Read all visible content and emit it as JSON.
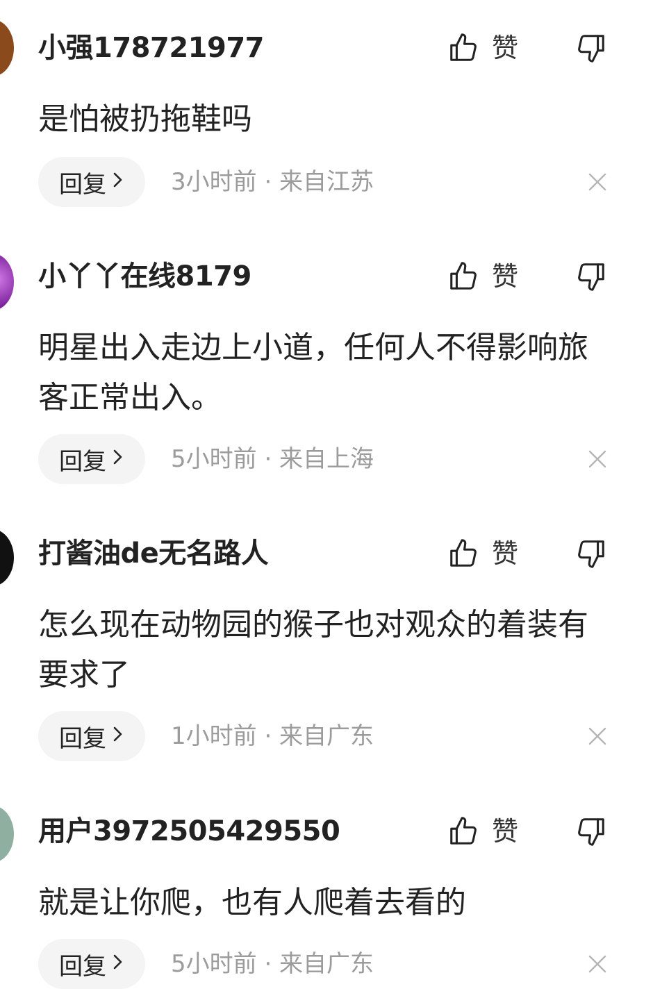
{
  "comments": [
    {
      "username": "小强178721977",
      "text": "是怕被扔拖鞋吗",
      "like_label": "赞",
      "reply_label": "回复",
      "meta": "3小时前 · 来自江苏",
      "avatar_color": "#8a4a1c"
    },
    {
      "username": "小丫丫在线8179",
      "text": "明星出入走边上小道，任何人不得影响旅客正常出入。",
      "like_label": "赞",
      "reply_label": "回复",
      "meta": "5小时前 · 来自上海",
      "avatar_color": "#a43bc4"
    },
    {
      "username": "打酱油de无名路人",
      "text": "怎么现在动物园的猴子也对观众的着装有要求了",
      "like_label": "赞",
      "reply_label": "回复",
      "meta": "1小时前 · 来自广东",
      "avatar_color": "#111111"
    },
    {
      "username": "用户3972505429550",
      "text": "就是让你爬，也有人爬着去看的",
      "like_label": "赞",
      "reply_label": "回复",
      "meta": "5小时前 · 来自广东",
      "avatar_color": "#8fb0a0"
    }
  ],
  "icons": {
    "like": "thumbs-up-icon",
    "dislike": "thumbs-down-icon",
    "close": "close-icon",
    "chevron": "chevron-right-icon"
  },
  "colors": {
    "meta_text": "#9b9b9b",
    "reply_bg": "#f4f4f5",
    "text": "#222222"
  }
}
